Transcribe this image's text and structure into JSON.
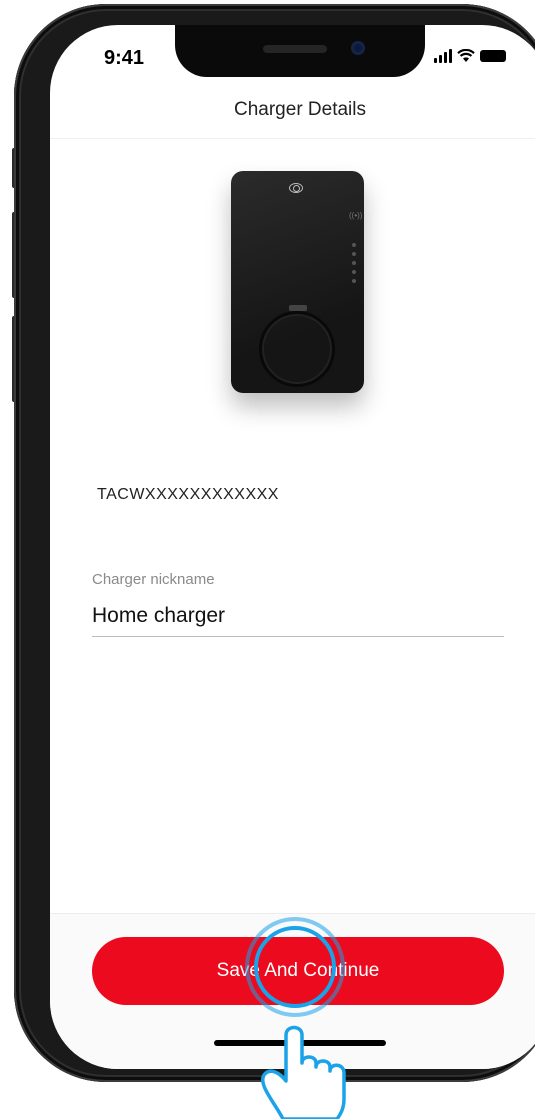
{
  "status_bar": {
    "time": "9:41"
  },
  "header": {
    "title": "Charger Details"
  },
  "charger": {
    "serial": "TACWXXXXXXXXXXXX",
    "nickname_label": "Charger nickname",
    "nickname_value": "Home charger"
  },
  "footer": {
    "save_label": "Save And Continue"
  },
  "colors": {
    "accent": "#eb0a1e",
    "tap_hint": "#1aa3e8"
  },
  "icons": [
    "signal-icon",
    "wifi-icon",
    "battery-icon",
    "charger-image",
    "tap-hand-icon"
  ]
}
